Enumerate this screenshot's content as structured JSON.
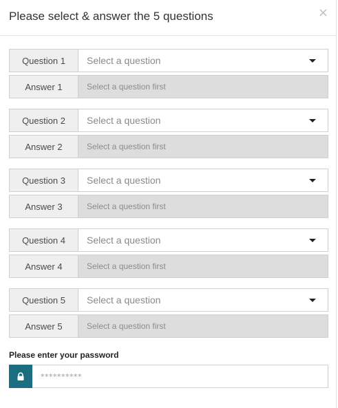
{
  "modal": {
    "title": "Please select & answer the 5 questions",
    "close_icon": "×"
  },
  "questions": [
    {
      "question_label": "Question 1",
      "select_placeholder": "Select a question",
      "answer_label": "Answer 1",
      "answer_placeholder": "Select a question first"
    },
    {
      "question_label": "Question 2",
      "select_placeholder": "Select a question",
      "answer_label": "Answer 2",
      "answer_placeholder": "Select a question first"
    },
    {
      "question_label": "Question 3",
      "select_placeholder": "Select a question",
      "answer_label": "Answer 3",
      "answer_placeholder": "Select a question first"
    },
    {
      "question_label": "Question 4",
      "select_placeholder": "Select a question",
      "answer_label": "Answer 4",
      "answer_placeholder": "Select a question first"
    },
    {
      "question_label": "Question 5",
      "select_placeholder": "Select a question",
      "answer_label": "Answer 5",
      "answer_placeholder": "Select a question first"
    }
  ],
  "password": {
    "label": "Please enter your password",
    "placeholder": "**********",
    "icon": "lock-icon"
  },
  "colors": {
    "lock_bg": "#1a6e80",
    "answer_bg": "#dddddd",
    "label_bg": "#efefef"
  }
}
